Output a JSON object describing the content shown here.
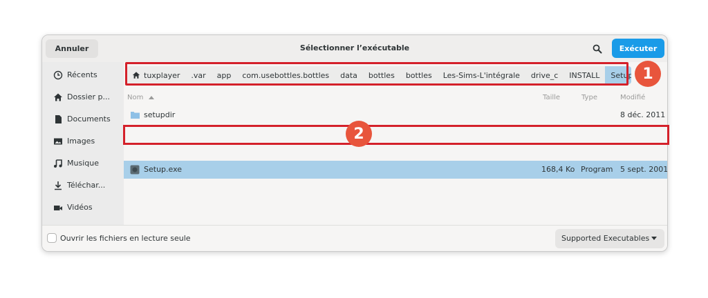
{
  "header": {
    "cancel_label": "Annuler",
    "title": "Sélectionner l’exécutable",
    "execute_label": "Exécuter",
    "search_icon": "search-icon"
  },
  "sidebar": {
    "items": [
      {
        "label": "Récents",
        "icon": "clock-icon"
      },
      {
        "label": "Dossier p...",
        "icon": "home-icon"
      },
      {
        "label": "Documents",
        "icon": "document-icon"
      },
      {
        "label": "Images",
        "icon": "image-icon"
      },
      {
        "label": "Musique",
        "icon": "music-icon"
      },
      {
        "label": "Téléchar...",
        "icon": "download-icon"
      },
      {
        "label": "Vidéos",
        "icon": "video-icon"
      }
    ]
  },
  "pathbar": {
    "crumbs": [
      "tuxplayer",
      ".var",
      "app",
      "com.usebottles.bottles",
      "data",
      "bottles",
      "bottles",
      "Les-Sims-L'intégrale",
      "drive_c",
      "INSTALL",
      "Setup"
    ],
    "active_index": 10
  },
  "columns": {
    "name": "Nom",
    "size": "Taille",
    "type": "Type",
    "modified": "Modifié"
  },
  "files": [
    {
      "name": "setupdir",
      "size": "",
      "type": "",
      "modified": "8 déc. 2011",
      "icon": "folder-icon"
    },
    {
      "name": "Setup.exe",
      "size": "168,4 Ko",
      "type": "Program",
      "modified": "5 sept. 2001",
      "icon": "exe-icon",
      "selected": true
    }
  ],
  "footer": {
    "readonly_label": "Ouvrir les fichiers en lecture seule",
    "readonly_checked": false,
    "filter_label": "Supported Executables"
  },
  "annotations": {
    "badge1": "1",
    "badge2": "2"
  },
  "colors": {
    "accent": "#1a9be8",
    "selection": "#a8cfe9",
    "annotation_red": "#d4202a",
    "badge": "#e8553c"
  }
}
